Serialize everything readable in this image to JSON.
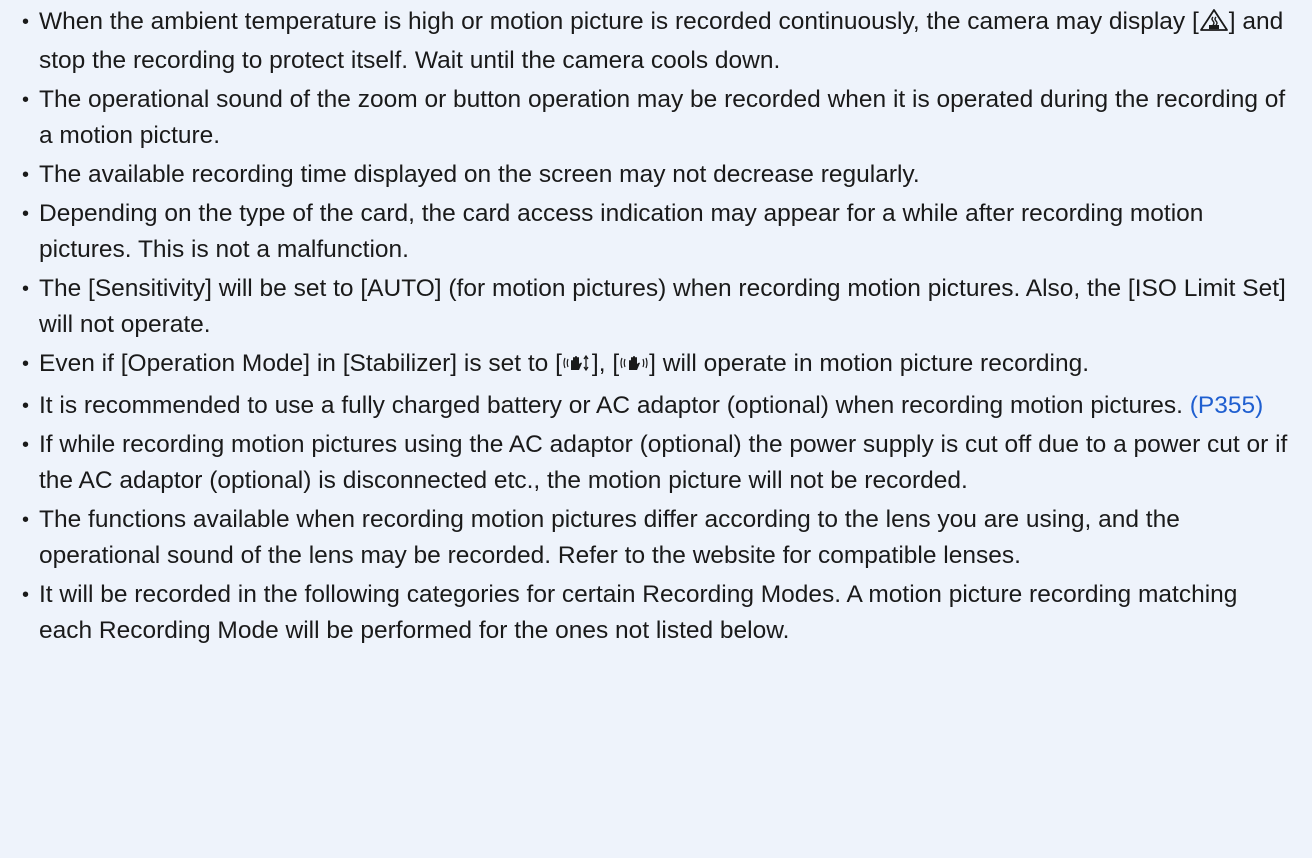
{
  "notes": [
    {
      "before_icon": "When the ambient temperature is high or motion picture is recorded continuously, the camera may display [",
      "icon": "temperature-warning-icon",
      "after_icon": "] and stop the recording to protect itself. Wait until the camera cools down."
    },
    {
      "text": "The operational sound of the zoom or button operation may be recorded when it is operated during the recording of a motion picture."
    },
    {
      "text": "The available recording time displayed on the screen may not decrease regularly."
    },
    {
      "text": "Depending on the type of the card, the card access indication may appear for a while after recording motion pictures. This is not a malfunction."
    },
    {
      "text": "The [Sensitivity] will be set to [AUTO] (for motion pictures) when recording motion pictures. Also, the [ISO Limit Set] will not operate."
    },
    {
      "part1": "Even if [Operation Mode] in [Stabilizer] is set to [",
      "icon1": "stabilizer-vertical-icon",
      "part2": "], [",
      "icon2": "stabilizer-normal-icon",
      "part3": "] will operate in motion picture recording."
    },
    {
      "text": "It is recommended to use a fully charged battery or AC adaptor (optional) when recording motion pictures. ",
      "link": "(P355)"
    },
    {
      "text": "If while recording motion pictures using the AC adaptor (optional) the power supply is cut off due to a power cut or if the AC adaptor (optional) is disconnected etc., the motion picture will not be recorded."
    },
    {
      "text": "The functions available when recording motion pictures differ according to the lens you are using, and the operational sound of the lens may be recorded. Refer to the website for compatible lenses."
    },
    {
      "text": "It will be recorded in the following categories for certain Recording Modes. A motion picture recording matching each Recording Mode will be performed for the ones not listed below."
    }
  ],
  "colors": {
    "background": "#eef3fb",
    "link": "#1f5fd0",
    "text": "#1a1a1a"
  }
}
